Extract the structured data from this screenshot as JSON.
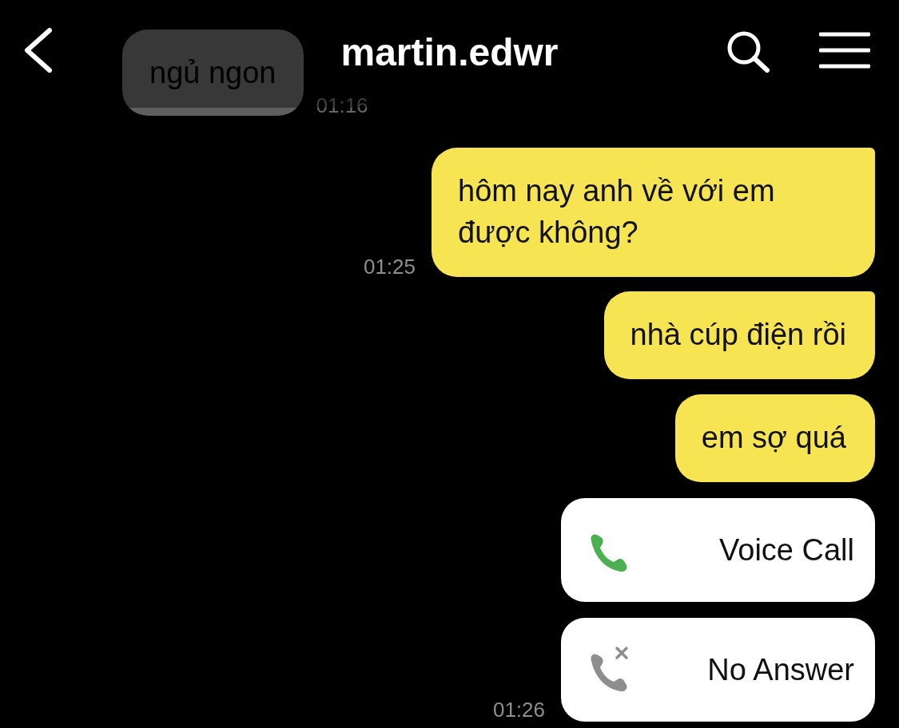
{
  "header": {
    "title": "martin.edwr"
  },
  "messages": [
    {
      "kind": "text",
      "outgoing": false,
      "faded": true,
      "text": "ngủ ngon",
      "time": "01:16",
      "tail": false
    },
    {
      "kind": "text",
      "outgoing": true,
      "faded": false,
      "text": "hôm nay anh về với em được không?",
      "time": "01:25",
      "tail": true
    },
    {
      "kind": "text",
      "outgoing": true,
      "faded": false,
      "text": "nhà cúp điện rồi",
      "tail": true
    },
    {
      "kind": "text",
      "outgoing": true,
      "faded": false,
      "text": "em sợ quá",
      "tail": false
    },
    {
      "kind": "voice_call",
      "outgoing": true,
      "text": "Voice Call"
    },
    {
      "kind": "missed_call",
      "outgoing": true,
      "text": "No Answer",
      "time": "01:26"
    }
  ]
}
